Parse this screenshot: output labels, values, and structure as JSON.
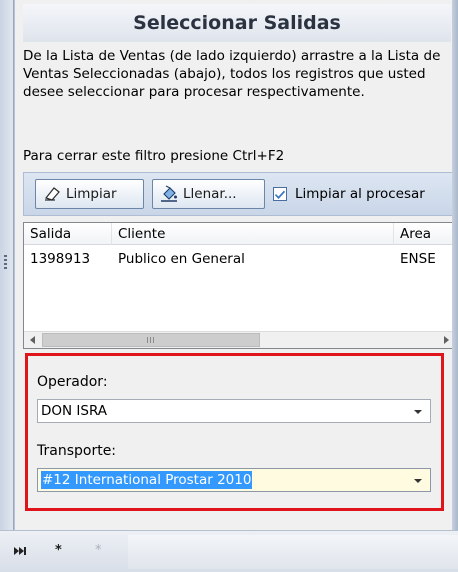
{
  "panel": {
    "title": "Seleccionar Salidas",
    "instructions": "De la Lista de Ventas (de lado izquierdo) arrastre a la Lista de Ventas Seleccionadas (abajo), todos los registros que usted desee seleccionar para procesar respectivamente.",
    "close_hint": "Para cerrar este filtro presione Ctrl+F2"
  },
  "toolbar": {
    "limpiar_label": "Limpiar",
    "llenar_label": "Llenar...",
    "limpiar_al_procesar_label": "Limpiar al procesar",
    "limpiar_al_procesar_checked": true
  },
  "grid": {
    "columns": [
      "Salida",
      "Cliente",
      "Area"
    ],
    "rows": [
      [
        "1398913",
        "Publico en General",
        "ENSE"
      ]
    ]
  },
  "form": {
    "operador_label": "Operador:",
    "operador_value": "DON ISRA",
    "transporte_label": "Transporte:",
    "transporte_value": "#12 International Prostar 2010"
  },
  "navigator": {
    "last_icon": "last-record-icon",
    "new_label": "*",
    "delete_label": "*"
  }
}
